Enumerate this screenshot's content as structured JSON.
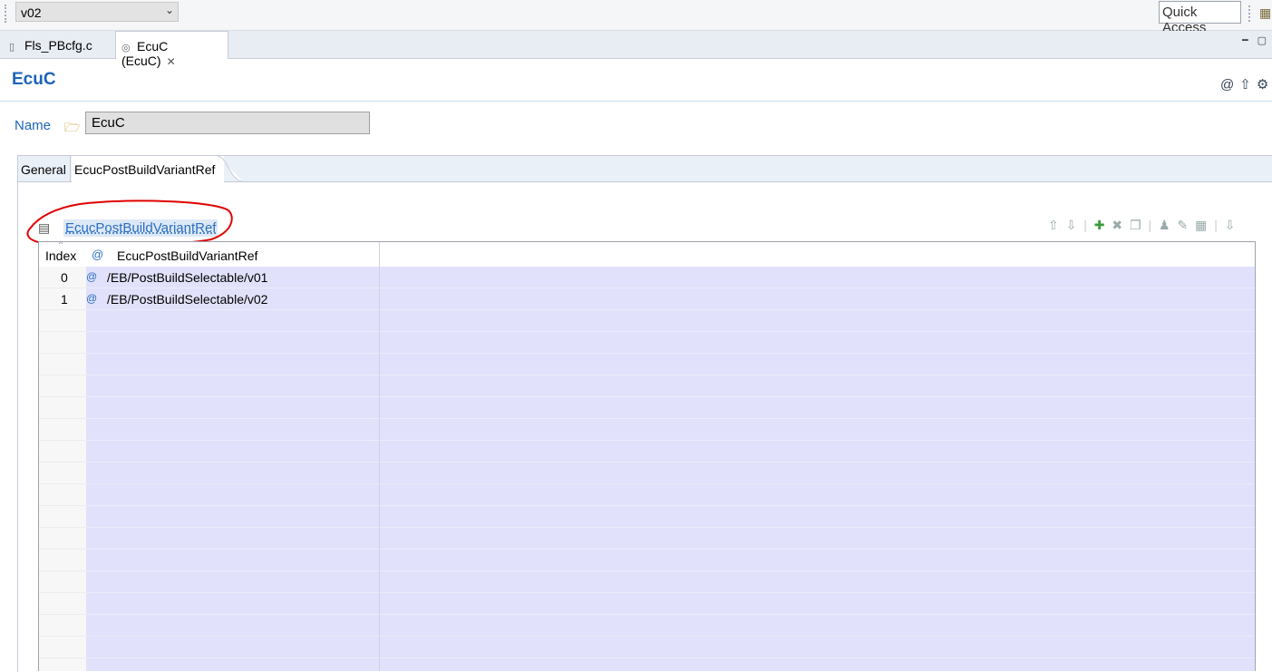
{
  "toolbar": {
    "variant_selected": "v02",
    "quick_access_label": "Quick Access"
  },
  "editor_tabs": [
    {
      "label": "Fls_PBcfg.c",
      "active": false
    },
    {
      "label": "EcuC (EcuC)",
      "active": true
    }
  ],
  "form": {
    "title": "EcuC",
    "name_label": "Name",
    "name_value": "EcuC"
  },
  "inner_tabs": [
    {
      "label": "General",
      "active": false
    },
    {
      "label": "EcucPostBuildVariantRef",
      "active": true
    }
  ],
  "section": {
    "title": "EcucPostBuildVariantRef"
  },
  "table": {
    "columns": [
      "Index",
      "EcucPostBuildVariantRef"
    ],
    "rows": [
      {
        "index": "0",
        "value": "/EB/PostBuildSelectable/v01"
      },
      {
        "index": "1",
        "value": "/EB/PostBuildSelectable/v02"
      }
    ]
  },
  "colors": {
    "accent": "#1d64b8",
    "row_fill": "#e1e1fb",
    "annotation": "#e00000"
  }
}
